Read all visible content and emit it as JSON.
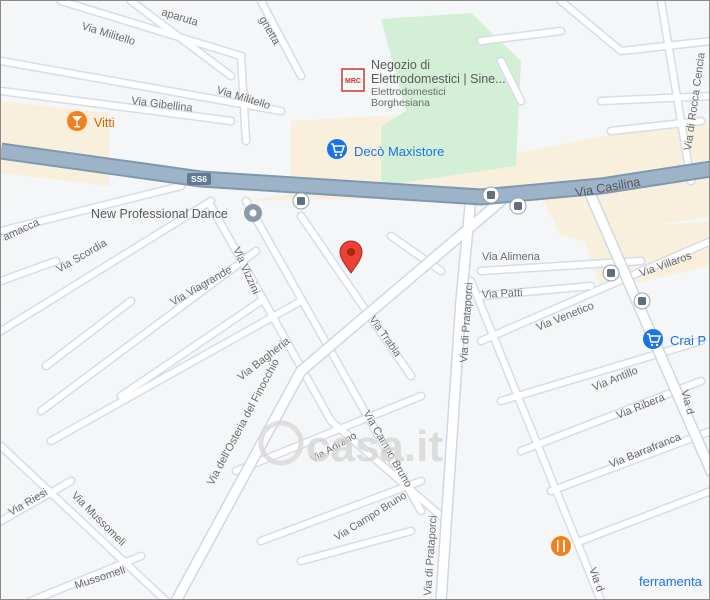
{
  "map": {
    "highway": {
      "name": "Via Casilina",
      "shield": "SS6"
    },
    "streets": {
      "militello_1": "Via Militello",
      "militello_2": "Via Militello",
      "gibellina": "Via Gibellina",
      "scordia": "Via Scordia",
      "viagrande": "Via Viagrande",
      "vizzini": "Via Vizzini",
      "bagheria": "Via Bagheria",
      "finocchio": "Via dell'Osteria del Finocchio",
      "campo_bruno_main": "Via Campo Bruno",
      "campo_bruno_small": "Via Campo Bruno",
      "adrano": "Via Adrano",
      "riesi": "Via Riesi",
      "mussomeli_1": "Via Mussomeli",
      "mussomeli_2": "Mussomeli",
      "prataporci_1": "Via di Prataporci",
      "prataporci_2": "Via di Prataporci",
      "alimena": "Via Alimena",
      "patti": "Via Patti",
      "venetico": "Via Venetico",
      "antillo": "Via Antillo",
      "ribera": "Via Ribera",
      "barrafranca": "Via Barrafranca",
      "villaros": "Via Villaros",
      "rocca_cencia": "Via di Rocca Cencia",
      "right_edge": "Via d",
      "bottom_partial": "Via d",
      "trabia": "Via Trabia",
      "top_partial_1": "aparuta",
      "top_partial_2": "gnetta",
      "left_partial": "amacca"
    },
    "pois": {
      "negozio_title_1": "Negozio di",
      "negozio_title_2": "Elettrodomestici | Sine...",
      "negozio_sub_1": "Elettrodomestici",
      "negozio_sub_2": "Borghesiana",
      "negozio_logo": "MRC",
      "vitti": "Vitti",
      "deco": "Decò Maxistore",
      "dance": "New Professional Dance",
      "crai": "Crai P",
      "ferramenta": "ferramenta"
    },
    "watermark": "casa.it",
    "colors": {
      "road_casing": "#d4dbe3",
      "highway": "#8fa8bf",
      "commercial": "#f8f0dc",
      "park": "#d3f0d7",
      "pin": "#ea4335",
      "poi_blue": "#1a73e8",
      "poi_orange": "#f3801f"
    }
  }
}
